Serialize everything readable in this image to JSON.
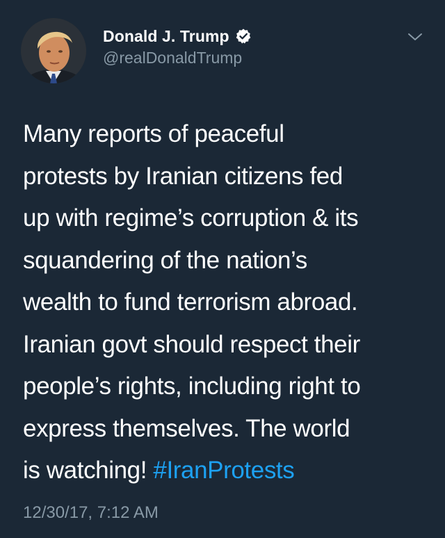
{
  "user": {
    "display_name": "Donald J. Trump",
    "handle": "@realDonaldTrump",
    "verified": true,
    "avatar_icon": "user-avatar"
  },
  "menu": {
    "icon": "chevron-down-icon"
  },
  "tweet": {
    "lines": [
      "Many reports of peaceful",
      "protests by Iranian citizens fed",
      "up with regime’s corruption & its",
      "squandering of the nation’s",
      "wealth to fund terrorism abroad.",
      "Iranian govt should respect their",
      "people’s rights, including right to",
      "express themselves. The world",
      "is watching! "
    ],
    "hashtag": "#IranProtests",
    "timestamp": "12/30/17, 7:12 AM"
  },
  "colors": {
    "background": "#1b2836",
    "text": "#ffffff",
    "secondary": "#8899a6",
    "link": "#1da1f2",
    "verified_badge": "#ffffff"
  }
}
